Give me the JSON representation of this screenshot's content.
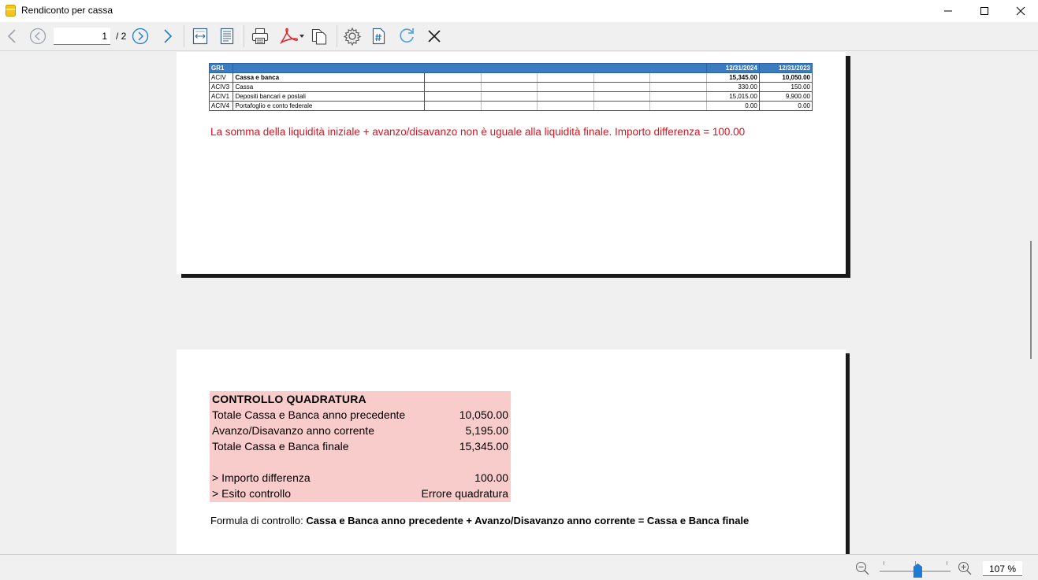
{
  "window": {
    "title": "Rendiconto per cassa"
  },
  "toolbar": {
    "current_page": "1",
    "page_total": "/ 2",
    "icons": [
      "arrow-left-icon",
      "circle-left-icon",
      "circle-right-icon",
      "arrow-right-icon",
      "fit-width-icon",
      "fit-page-icon",
      "print-icon",
      "pdf-icon",
      "copy-pages-icon",
      "settings-icon",
      "hash-doc-icon",
      "refresh-icon",
      "close-icon"
    ]
  },
  "page1": {
    "table": {
      "header": {
        "code": "GR1",
        "desc": "",
        "col1": "12/31/2024",
        "col2": "12/31/2023"
      },
      "rows": [
        {
          "code": "ACIV",
          "desc": "Cassa e banca",
          "v1": "15,345.00",
          "v2": "10,050.00",
          "bold": true
        },
        {
          "code": "ACIV3",
          "desc": "Cassa",
          "v1": "330.00",
          "v2": "150.00",
          "bold": false
        },
        {
          "code": "ACIV1",
          "desc": "Depositi bancari e postali",
          "v1": "15,015.00",
          "v2": "9,900.00",
          "bold": false
        },
        {
          "code": "ACIV4",
          "desc": "Portafoglio e conto federale",
          "v1": "0.00",
          "v2": "0.00",
          "bold": false
        }
      ]
    },
    "warning": "La somma della liquidità iniziale + avanzo/disavanzo non è uguale alla liquidità finale. Importo differenza = 100.00"
  },
  "page2": {
    "control": {
      "title": "CONTROLLO QUADRATURA",
      "rows": [
        {
          "label": "Totale Cassa e Banca anno precedente",
          "value": "10,050.00"
        },
        {
          "label": "Avanzo/Disavanzo anno corrente",
          "value": "5,195.00"
        },
        {
          "label": "Totale Cassa e Banca finale",
          "value": "15,345.00"
        },
        {
          "label": "> Importo differenza",
          "value": "100.00"
        },
        {
          "label": "> Esito controllo",
          "value": "Errore quadratura"
        }
      ]
    },
    "formula": {
      "prefix": "Formula di controllo:",
      "text": "Cassa e Banca anno precedente + Avanzo/Disavanzo anno corrente = Cassa e Banca finale"
    }
  },
  "statusbar": {
    "zoom": "107 %"
  },
  "colors": {
    "header_blue": "#3b7bbf",
    "warning_red": "#e0101e",
    "control_bg": "#f9cccc",
    "accent_blue": "#1e7bd6"
  }
}
